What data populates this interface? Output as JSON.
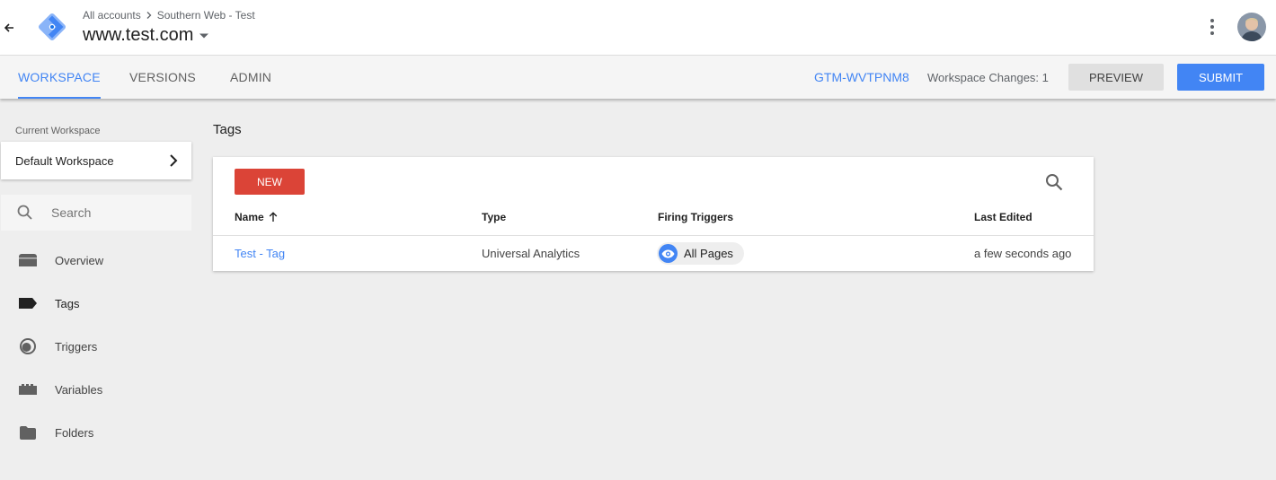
{
  "header": {
    "breadcrumb": [
      "All accounts",
      "Southern Web - Test"
    ],
    "container_name": "www.test.com",
    "back_icon": "arrow-left-icon",
    "logo": "gtm-logo",
    "menu_icon": "more-vert-icon",
    "avatar": "user-avatar"
  },
  "nav": {
    "tabs": [
      {
        "label": "WORKSPACE",
        "active": true
      },
      {
        "label": "VERSIONS",
        "active": false
      },
      {
        "label": "ADMIN",
        "active": false
      }
    ],
    "container_id": "GTM-WVTPNM8",
    "workspace_changes": "Workspace Changes: 1",
    "preview_label": "PREVIEW",
    "submit_label": "SUBMIT"
  },
  "sidebar": {
    "current_workspace_label": "Current Workspace",
    "current_workspace": "Default Workspace",
    "search_placeholder": "Search",
    "items": [
      {
        "label": "Overview",
        "icon": "overview-icon",
        "active": false
      },
      {
        "label": "Tags",
        "icon": "tag-icon",
        "active": true
      },
      {
        "label": "Triggers",
        "icon": "trigger-icon",
        "active": false
      },
      {
        "label": "Variables",
        "icon": "variables-icon",
        "active": false
      },
      {
        "label": "Folders",
        "icon": "folder-icon",
        "active": false
      }
    ]
  },
  "main": {
    "title": "Tags",
    "new_label": "NEW",
    "columns": [
      "Name",
      "Type",
      "Firing Triggers",
      "Last Edited"
    ],
    "sort_icon": "arrow-up-icon",
    "rows": [
      {
        "name": "Test - Tag",
        "type": "Universal Analytics",
        "trigger": "All Pages",
        "last_edited": "a few seconds ago"
      }
    ]
  },
  "colors": {
    "accent": "#4285f4",
    "new_button": "#db4437",
    "background": "#eeeeee"
  }
}
